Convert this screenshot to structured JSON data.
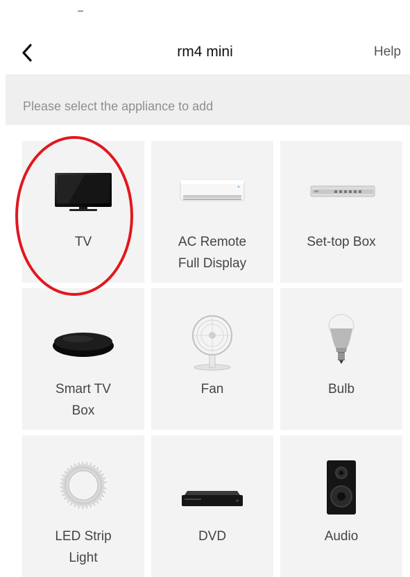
{
  "header": {
    "back_icon": "chevron-left-icon",
    "title": "rm4 mini",
    "help_label": "Help"
  },
  "instruction": "Please select the appliance to add",
  "appliances": [
    {
      "label": "TV",
      "icon": "tv-icon",
      "highlighted": true
    },
    {
      "label": "AC Remote\nFull Display",
      "icon": "air-conditioner-icon"
    },
    {
      "label": "Set-top Box",
      "icon": "set-top-box-icon"
    },
    {
      "label": "Smart TV\nBox",
      "icon": "smart-tv-box-icon"
    },
    {
      "label": "Fan",
      "icon": "fan-icon"
    },
    {
      "label": "Bulb",
      "icon": "bulb-icon"
    },
    {
      "label": "LED Strip\nLight",
      "icon": "led-strip-icon"
    },
    {
      "label": "DVD",
      "icon": "dvd-player-icon"
    },
    {
      "label": "Audio",
      "icon": "speaker-icon"
    }
  ],
  "colors": {
    "highlight": "#e2171f",
    "tile_background": "#f3f3f3",
    "subheader_background": "#efefef"
  }
}
